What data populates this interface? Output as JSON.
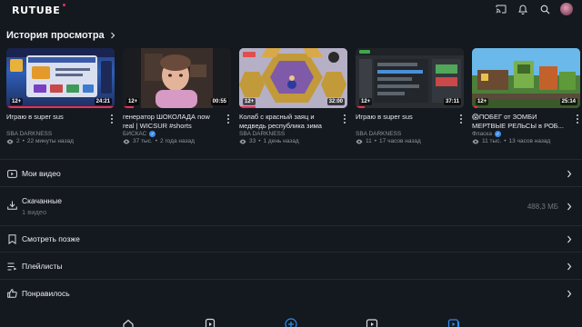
{
  "app": {
    "logo": "RUTUBE"
  },
  "topbar": {
    "icons": [
      "cast-icon",
      "bell-icon",
      "search-icon",
      "avatar"
    ]
  },
  "history": {
    "title": "История просмотра",
    "videos": [
      {
        "title": "Играю в super sus",
        "channel": "SBA DARKNESS",
        "verified": false,
        "views": "2",
        "time": "22 минуты назад",
        "duration": "24:21",
        "age": "12+",
        "progress": 1.0
      },
      {
        "title": "генератор ШОКОЛАДА now real | WICSUR #shorts",
        "channel": "БИСКАС",
        "verified": true,
        "views": "37 тыс.",
        "time": "2 года назад",
        "duration": "00:55",
        "age": "12+",
        "progress": 0.1
      },
      {
        "title": "Колаб с красный заяц и медведь республика зима",
        "channel": "SBA DARKNESS",
        "verified": false,
        "views": "33",
        "time": "1 день назад",
        "duration": "32:00",
        "age": "12+",
        "progress": 0.15
      },
      {
        "title": "Играю в super sus",
        "channel": "SBA DARKNESS",
        "verified": false,
        "views": "11",
        "time": "17 часов назад",
        "duration": "37:11",
        "age": "12+",
        "progress": 0.08
      },
      {
        "title": "😱ПОБЕГ от ЗОМБИ МЕРТВЫЕ РЕЛЬСЫ в РОБ...",
        "channel": "Фласка",
        "verified": true,
        "views": "11 тыс.",
        "time": "13 часов назад",
        "duration": "25:14",
        "age": "12+",
        "progress": 0.05
      }
    ]
  },
  "menu": {
    "my_videos": {
      "label": "Мои видео"
    },
    "downloads": {
      "label": "Скачанные",
      "sub": "1 видео",
      "size": "488,3 МБ"
    },
    "watch_later": {
      "label": "Смотреть позже"
    },
    "playlists": {
      "label": "Плейлисты"
    },
    "liked": {
      "label": "Понравилось"
    }
  },
  "colors": {
    "accent": "#ed2f52",
    "verified": "#3f8ef0",
    "nav_active": "#2f8cf0"
  }
}
